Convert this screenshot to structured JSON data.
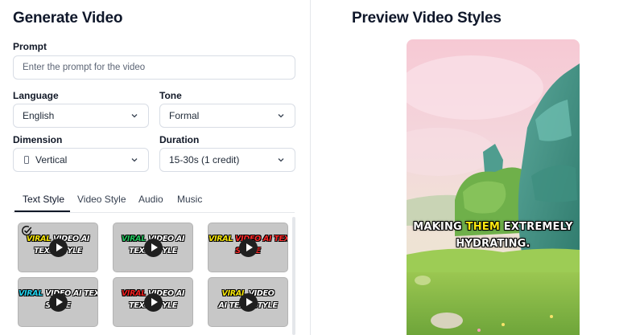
{
  "left": {
    "title": "Generate Video",
    "prompt": {
      "label": "Prompt",
      "placeholder": "Enter the prompt for the video"
    },
    "language": {
      "label": "Language",
      "value": "English"
    },
    "tone": {
      "label": "Tone",
      "value": "Formal"
    },
    "dimension": {
      "label": "Dimension",
      "value": "Vertical"
    },
    "duration": {
      "label": "Duration",
      "value": "15-30s (1 credit)"
    },
    "tabs": [
      "Text Style",
      "Video Style",
      "Audio",
      "Music"
    ],
    "styles": [
      {
        "line1a": "VIRAL",
        "line1b": " VIDEO AI",
        "line2": "TEXT STYLE",
        "color_a": "#f5e50a",
        "color_b": "#ffffff",
        "color_line2": "#ffffff",
        "selected": true
      },
      {
        "line1a": "VIRAL",
        "line1b": " VIDEO AI",
        "line2": "TEXT STYLE",
        "color_a": "#22c55e",
        "color_b": "#ffffff",
        "color_line2": "#ffffff",
        "selected": false
      },
      {
        "line1a": "VIRAL",
        "line1b": " VIDEO AI TEXT",
        "line2": "STYLE",
        "color_a": "#f5e50a",
        "color_b": "#ff2a2a",
        "color_line2": "#ff2a2a",
        "selected": false
      },
      {
        "line1a": "VIRAL",
        "line1b": " VIDEO AI TEXT",
        "line2": "STYLE",
        "color_a": "#22d3ee",
        "color_b": "#ffffff",
        "color_line2": "#ffffff",
        "selected": false
      },
      {
        "line1a": "VIRAL",
        "line1b": " VIDEO AI",
        "line2": "TEXT STYLE",
        "color_a": "#ef2020",
        "color_b": "#ffffff",
        "color_line2": "#ffffff",
        "selected": false
      },
      {
        "line1a": "VIRAL",
        "line1b": " VIDEO",
        "line2": "AI TEXT STYLE",
        "color_a": "#f5e50a",
        "color_b": "#ffffff",
        "color_line2": "#ffffff",
        "selected": false
      }
    ]
  },
  "right": {
    "title": "Preview Video Styles",
    "caption_line1_a": "MAKING ",
    "caption_line1_hl": "THEM",
    "caption_line1_b": " EXTREMELY",
    "caption_line2": "HYDRATING."
  },
  "colors": {
    "accent_highlight": "#fde910",
    "tab_underline": "#111827"
  }
}
